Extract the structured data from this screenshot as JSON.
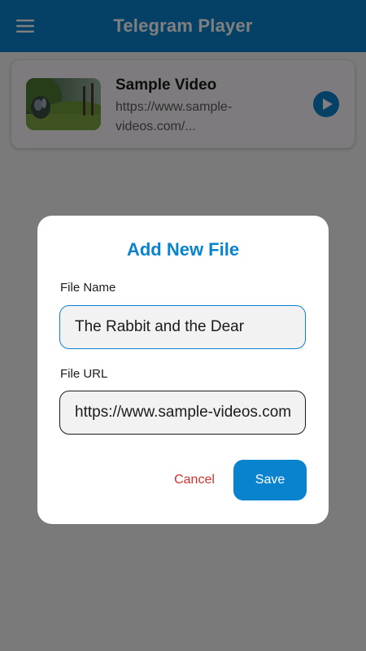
{
  "app_bar": {
    "title": "Telegram Player",
    "menu_icon": "hamburger-menu-icon",
    "background_color": "#0a83cf"
  },
  "video_list": [
    {
      "title": "Sample Video",
      "url": "https://www.sample-videos.com/...",
      "thumbnail": "rabbit-in-forest-thumbnail",
      "action_icon": "play-circle-icon"
    }
  ],
  "dialog": {
    "title": "Add New File",
    "file_name": {
      "label": "File Name",
      "value": "The Rabbit and the Dear"
    },
    "file_url": {
      "label": "File URL",
      "value": "https://www.sample-videos.com/"
    },
    "cancel_label": "Cancel",
    "save_label": "Save"
  },
  "colors": {
    "accent": "#0a83cf",
    "cancel": "#d1322e"
  }
}
